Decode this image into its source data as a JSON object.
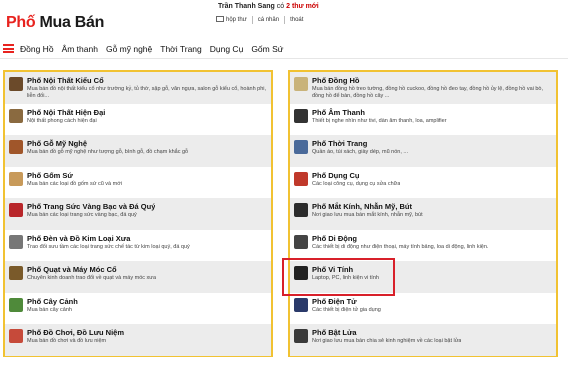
{
  "logo": {
    "part1": "Phố",
    "part2": "Mua Bán"
  },
  "user": {
    "name": "Trần Thanh Sang",
    "msg_prefix": "có",
    "msg_count": "2 thư mới"
  },
  "top_links": [
    "hộp thư",
    "cá nhân",
    "thoát"
  ],
  "nav": [
    "Đồng Hồ",
    "Âm thanh",
    "Gỗ mỹ nghệ",
    "Thời Trang",
    "Dụng Cụ",
    "Gốm Sứ"
  ],
  "left_categories": [
    {
      "title": "Phố Nội Thất Kiểu Cổ",
      "desc": "Mua bán đồ nội thất kiểu cổ như trường kỷ, tủ thờ, sập gỗ, văn ngựa, salon gỗ kiểu cổ, hoành phi, liễn đối...",
      "icon": "antique-furniture-icon",
      "color": "#6b4a2a"
    },
    {
      "title": "Phố Nội Thất Hiện Đại",
      "desc": "Nội thất phong cách hiện đại",
      "icon": "modern-furniture-icon",
      "color": "#8a6a40"
    },
    {
      "title": "Phố Gỗ Mỹ Nghệ",
      "desc": "Mua bán đồ gỗ mỹ nghệ như tượng gỗ, bình gỗ, đồ chạm khắc gỗ",
      "icon": "wood-carving-icon",
      "color": "#a0562a"
    },
    {
      "title": "Phố Gốm Sứ",
      "desc": "Mua bán các loại đồ gốm sứ cũ và mới",
      "icon": "ceramics-icon",
      "color": "#c89a5a"
    },
    {
      "title": "Phố Trang Sức Vàng Bạc và Đá Quý",
      "desc": "Mua bán các loại trang sức vàng bạc, đá quý",
      "icon": "jewelry-icon",
      "color": "#b8262a"
    },
    {
      "title": "Phố Đèn và Đồ Kim Loại Xưa",
      "desc": "Trao đổi sưu tầm các loại trang sức chế tác từ kim loại quý, đá quý",
      "icon": "lamp-icon",
      "color": "#777777"
    },
    {
      "title": "Phố Quạt và Máy Móc Cổ",
      "desc": "Chuyên kinh doanh trao đổi về quạt và máy móc xưa",
      "icon": "fan-icon",
      "color": "#7a5a2a"
    },
    {
      "title": "Phố Cây Cảnh",
      "desc": "Mua bán cây cảnh",
      "icon": "bonsai-icon",
      "color": "#4f8a3a"
    },
    {
      "title": "Phố Đồ Chơi, Đồ Lưu Niệm",
      "desc": "Mua bán đồ chơi và đồ lưu niệm",
      "icon": "toy-icon",
      "color": "#c64a3a"
    }
  ],
  "right_categories": [
    {
      "title": "Phố Đồng Hồ",
      "desc": "Mua bán đồng hồ treo tường, đồng hồ cuckoo, đồng hồ đeo tay, đồng hồ ủy lệ, đồng hồ vai bò, đồng hồ để bàn, đồng hồ cây ...",
      "icon": "clock-icon",
      "color": "#c9b37a"
    },
    {
      "title": "Phố Âm Thanh",
      "desc": "Thiết bị nghe nhìn như tivi, dàn âm thanh, loa, amplifier",
      "icon": "speaker-icon",
      "color": "#333333"
    },
    {
      "title": "Phố Thời Trang",
      "desc": "Quần áo, túi xách, giày dép, mũ nón, ...",
      "icon": "fashion-icon",
      "color": "#4a6a9a"
    },
    {
      "title": "Phố Dụng Cụ",
      "desc": "Các loại công cụ, dụng cụ sửa chữa",
      "icon": "tools-icon",
      "color": "#c0392b"
    },
    {
      "title": "Phố Mắt Kính, Nhẫn Mỹ, Bút",
      "desc": "Nơi giao lưu mua bán mắt kính, nhẫn mỹ, bút",
      "icon": "glasses-icon",
      "color": "#2b2b2b"
    },
    {
      "title": "Phố Di Động",
      "desc": "Các thiết bị di động như điện thoại, máy tính bảng, loa di động, linh kiện.",
      "icon": "mobile-icon",
      "color": "#444444"
    },
    {
      "title": "Phố Vi Tính",
      "desc": "Laptop, PC, linh kiện vi tính",
      "icon": "laptop-icon",
      "color": "#222222"
    },
    {
      "title": "Phố Điện Tử",
      "desc": "Các thiết bị điện tử gia dụng",
      "icon": "electronics-icon",
      "color": "#2a3a6a"
    },
    {
      "title": "Phố Bật Lửa",
      "desc": "Nơi giao lưu mua bán chia sẻ kinh nghiệm về các loại bật lửa",
      "icon": "lighter-icon",
      "color": "#3a3a3a"
    }
  ],
  "highlight_color": "#d8202a"
}
